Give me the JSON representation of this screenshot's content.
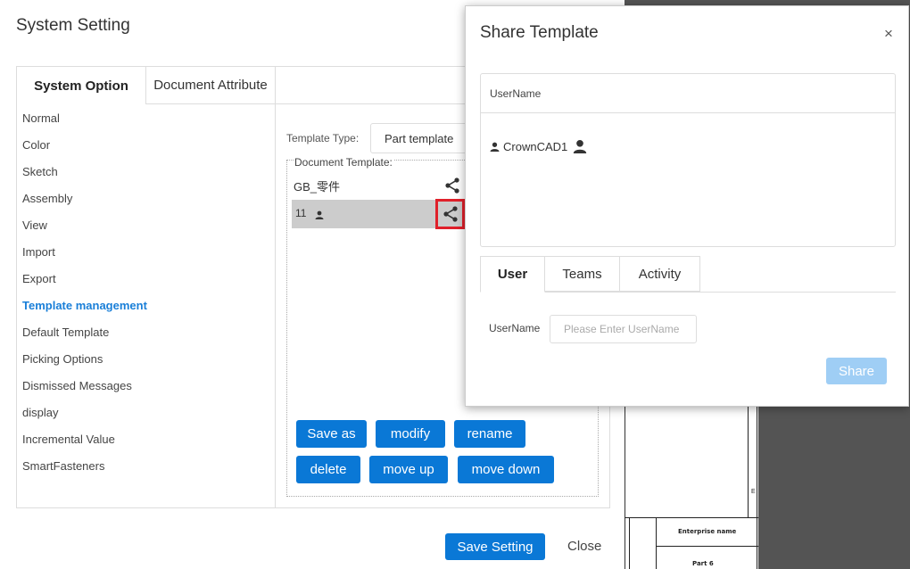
{
  "system_setting": {
    "title": "System Setting",
    "tabs": [
      {
        "label": "System Option",
        "active": true
      },
      {
        "label": "Document Attribute",
        "active": false
      }
    ],
    "sidebar": [
      {
        "label": "Normal"
      },
      {
        "label": "Color"
      },
      {
        "label": "Sketch"
      },
      {
        "label": "Assembly"
      },
      {
        "label": "View"
      },
      {
        "label": "Import"
      },
      {
        "label": "Export"
      },
      {
        "label": "Template management",
        "active": true
      },
      {
        "label": "Default Template"
      },
      {
        "label": "Picking Options"
      },
      {
        "label": "Dismissed Messages"
      },
      {
        "label": "display"
      },
      {
        "label": "Incremental Value"
      },
      {
        "label": "SmartFasteners"
      }
    ],
    "template_type_label": "Template Type:",
    "template_type_value": "Part template",
    "document_template_label": "Document Template:",
    "templates": [
      {
        "name": "GB_零件"
      },
      {
        "name": "11"
      }
    ],
    "buttons": {
      "save_as": "Save as",
      "modify": "modify",
      "rename": "rename",
      "delete": "delete",
      "move_up": "move up",
      "move_down": "move down"
    },
    "save_setting": "Save Setting",
    "close": "Close"
  },
  "share_template": {
    "title": "Share Template",
    "close_glyph": "×",
    "table_header": "UserName",
    "users": [
      {
        "name": "CrownCAD1"
      }
    ],
    "tabs": [
      {
        "label": "User",
        "active": true
      },
      {
        "label": "Teams",
        "active": false
      },
      {
        "label": "Activity",
        "active": false
      }
    ],
    "username_label": "UserName",
    "username_placeholder": "Please Enter UserName",
    "share_button": "Share"
  },
  "cad_sheet": {
    "enterprise_label": "Enterprise name",
    "part_label": "Part 6",
    "zone_label": "E"
  },
  "colors": {
    "primary": "#0a78d6",
    "active_link": "#1a7fd8",
    "highlight_box": "#e0202a",
    "disabled_button": "#9fcef5"
  }
}
